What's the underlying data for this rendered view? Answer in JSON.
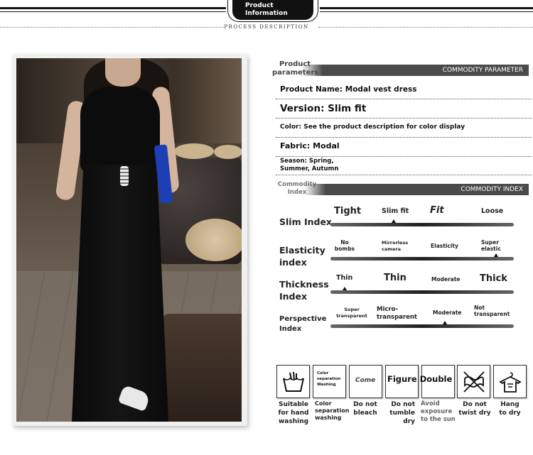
{
  "header": {
    "badge_line1": "Product",
    "badge_line2": "Information",
    "subtitle": "PROCESS DESCRIPTION"
  },
  "parameters": {
    "section_title_line1": "Product",
    "section_title_line2": "parameters",
    "section_bar": "COMMODITY PARAMETER",
    "rows": [
      "Product Name: Modal vest dress",
      "Version: Slim fit",
      "Color: See the product description for color display",
      "Fabric: Modal",
      "Season: Spring,",
      "Summer, Autumn"
    ]
  },
  "indexes": {
    "section_title_line1": "Commodity",
    "section_title_line2": "Index",
    "section_bar": "COMMODITY INDEX",
    "slim": {
      "label": "Slim Index",
      "options": [
        "Tight",
        "Slim fit",
        "Fit",
        "Loose"
      ],
      "selected": "Slim fit"
    },
    "elasticity": {
      "label_line1": "Elasticity",
      "label_line2": "index",
      "options": [
        "No",
        "bombs",
        "Mirrorless",
        "camera",
        "Elasticity",
        "Super",
        "elastic"
      ],
      "selected": "Super elastic"
    },
    "thickness": {
      "label_line1": "Thickness",
      "label_line2": "Index",
      "options": [
        "Thin",
        "Thin",
        "Moderate",
        "Thick"
      ],
      "selected": "Thin"
    },
    "perspective": {
      "label_line1": "Perspective",
      "label_line2": "Index",
      "options": [
        "Super",
        "transparent",
        "Micro-",
        "transparent",
        "Moderate",
        "Not",
        "transparent"
      ],
      "selected": "Moderate"
    }
  },
  "care": {
    "box_texts": {
      "color_sep_1": "Color",
      "color_sep_2": "separation",
      "color_sep_3": "Washing",
      "come": "Come",
      "figure_double": "Figure Double"
    },
    "labels": [
      [
        "Suitable",
        "for hand",
        "washing"
      ],
      [
        "Color",
        "separation",
        "washing"
      ],
      [
        "Do not",
        "bleach"
      ],
      [
        "Do not",
        "tumble",
        "dry"
      ],
      [
        "Avoid",
        "exposure",
        "to the sun"
      ],
      [
        "Do not",
        "twist dry"
      ],
      [
        "Hang",
        "to dry"
      ]
    ]
  }
}
